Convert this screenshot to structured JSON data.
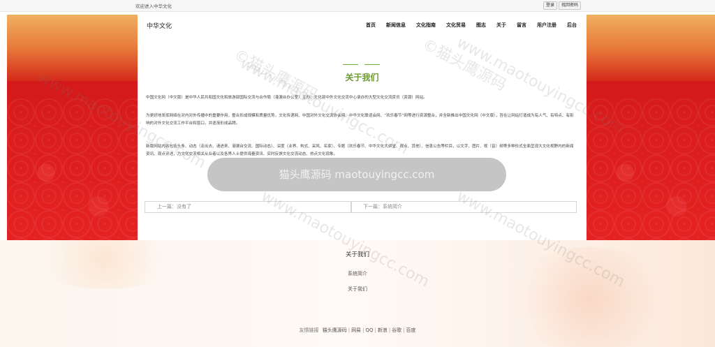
{
  "topbar": {
    "welcome": "欢迎进入中华文化",
    "login": "登录",
    "recover_password": "找回密码"
  },
  "header": {
    "brand": "中华文化",
    "nav": [
      "首页",
      "新闻信息",
      "文化指南",
      "文化贸易",
      "图志",
      "关于",
      "留言",
      "用户注册",
      "后台"
    ]
  },
  "content": {
    "title": "关于我们",
    "paragraphs": [
      "中国文化网（中文版）是中华人民共和国文化和旅游部国际交流与合作局（港澳台办公室）主办，文化部中外文化交流中心承办的大型文化交流资讯（资源）网站。",
      "为更好地发挥网络在对内对外传播中的重要作用，整合形成规模和质量优势，文化传递网、中国对外文化交流协会网、中华文化联谊会网、“欢乐春节”网等进行资源整合，并全新推出中国文化网（中文版），旨在让网站打造成为有人气、有特点、有影响的对外文化交流工作平台和窗口，并逐渐形成品牌。",
      "新版网站内容包括头条、动态（走出去、请进来、港澳台交流、国际动态）、深度（业界、构式、采风、名家）、专题（欢乐春节、中华文化大讲堂、视点、其他）、信息公告等栏目，以文字、图片、视（音）频等多种形式全面呈现大文化视野内的新闻资讯、观点评述，为文化交流相关从业者以及各界人士提供海量资讯、实时反馈文化交流动态、热点文化现象。"
    ],
    "prev": "上一篇：没有了",
    "next": "下一篇：系统简介"
  },
  "footer": {
    "title": "关于我们",
    "links": [
      "系统简介",
      "关于我们"
    ],
    "friends_label": "友情链接",
    "friends": [
      "猫头鹰源码",
      "网易",
      "QQ",
      "新浪",
      "谷歌",
      "百度"
    ],
    "separator": "|"
  },
  "watermark": {
    "url": "www.maotouyingcc.com",
    "mark": "©猫头鹰源码",
    "banner": "猫头鹰源码 maotouyingcc.com"
  }
}
